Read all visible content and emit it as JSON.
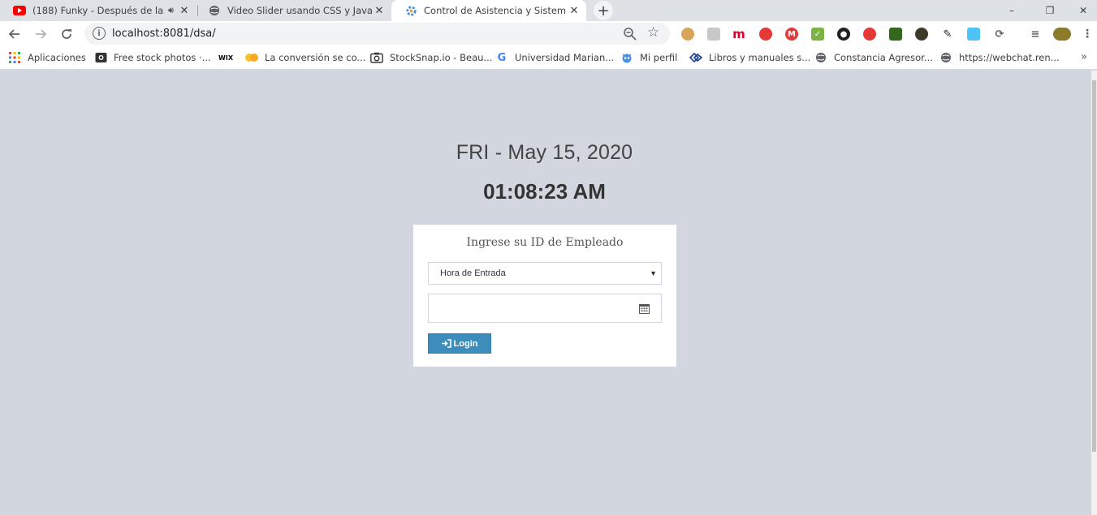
{
  "browser": {
    "tabs": [
      {
        "title": "(188) Funky - Después de la",
        "favicon": "youtube-icon",
        "audio": true
      },
      {
        "title": "Video Slider usando CSS y JavaSc",
        "favicon": "globe-icon"
      },
      {
        "title": "Control de Asistencia y Sistema d",
        "favicon": "gear-icon",
        "active": true
      }
    ],
    "new_tab_label": "+",
    "window_controls": {
      "minimize": "–",
      "restore": "❐",
      "close": "✕"
    },
    "url": "localhost:8081/dsa/",
    "extensions": [
      "cookie-icon",
      "box-icon",
      "m-icon",
      "hand-icon",
      "gmail-icon",
      "check-icon",
      "record-icon",
      "pin-icon",
      "shirt-icon",
      "python-icon",
      "tools-icon",
      "square-icon",
      "sync-icon",
      "playlist-icon",
      "avatar-icon"
    ],
    "bookmarks": [
      {
        "label": "Aplicaciones",
        "icon": "apps-grid-icon"
      },
      {
        "label": "Free stock photos ·...",
        "icon": "camera-icon"
      },
      {
        "label": "",
        "icon": "wix-icon",
        "icon_text": "WIX"
      },
      {
        "label": "La conversión se co...",
        "icon": "emoji-icon"
      },
      {
        "label": "StockSnap.io - Beau...",
        "icon": "camera-icon"
      },
      {
        "label": "Universidad Marian...",
        "icon": "google-icon",
        "icon_text": "G"
      },
      {
        "label": "Mi perfil",
        "icon": "robot-icon"
      },
      {
        "label": "Libros y manuales s...",
        "icon": "books-icon"
      },
      {
        "label": "Constancia Agresor...",
        "icon": "globe-icon"
      },
      {
        "label": "https://webchat.ren...",
        "icon": "globe-icon"
      }
    ],
    "bookmarks_more": "»"
  },
  "page": {
    "date": "FRI - May 15, 2020",
    "time": "01:08:23 AM",
    "login": {
      "title": "Ingrese su ID de Empleado",
      "select_value": "Hora de Entrada",
      "select_caret": "▼",
      "id_value": "",
      "button_label": "Login",
      "button_icon": "sign-in-icon"
    }
  },
  "colors": {
    "page_bg": "#d2d6de",
    "button_bg": "#3c8dbc",
    "tab_strip": "#dee1e6"
  }
}
